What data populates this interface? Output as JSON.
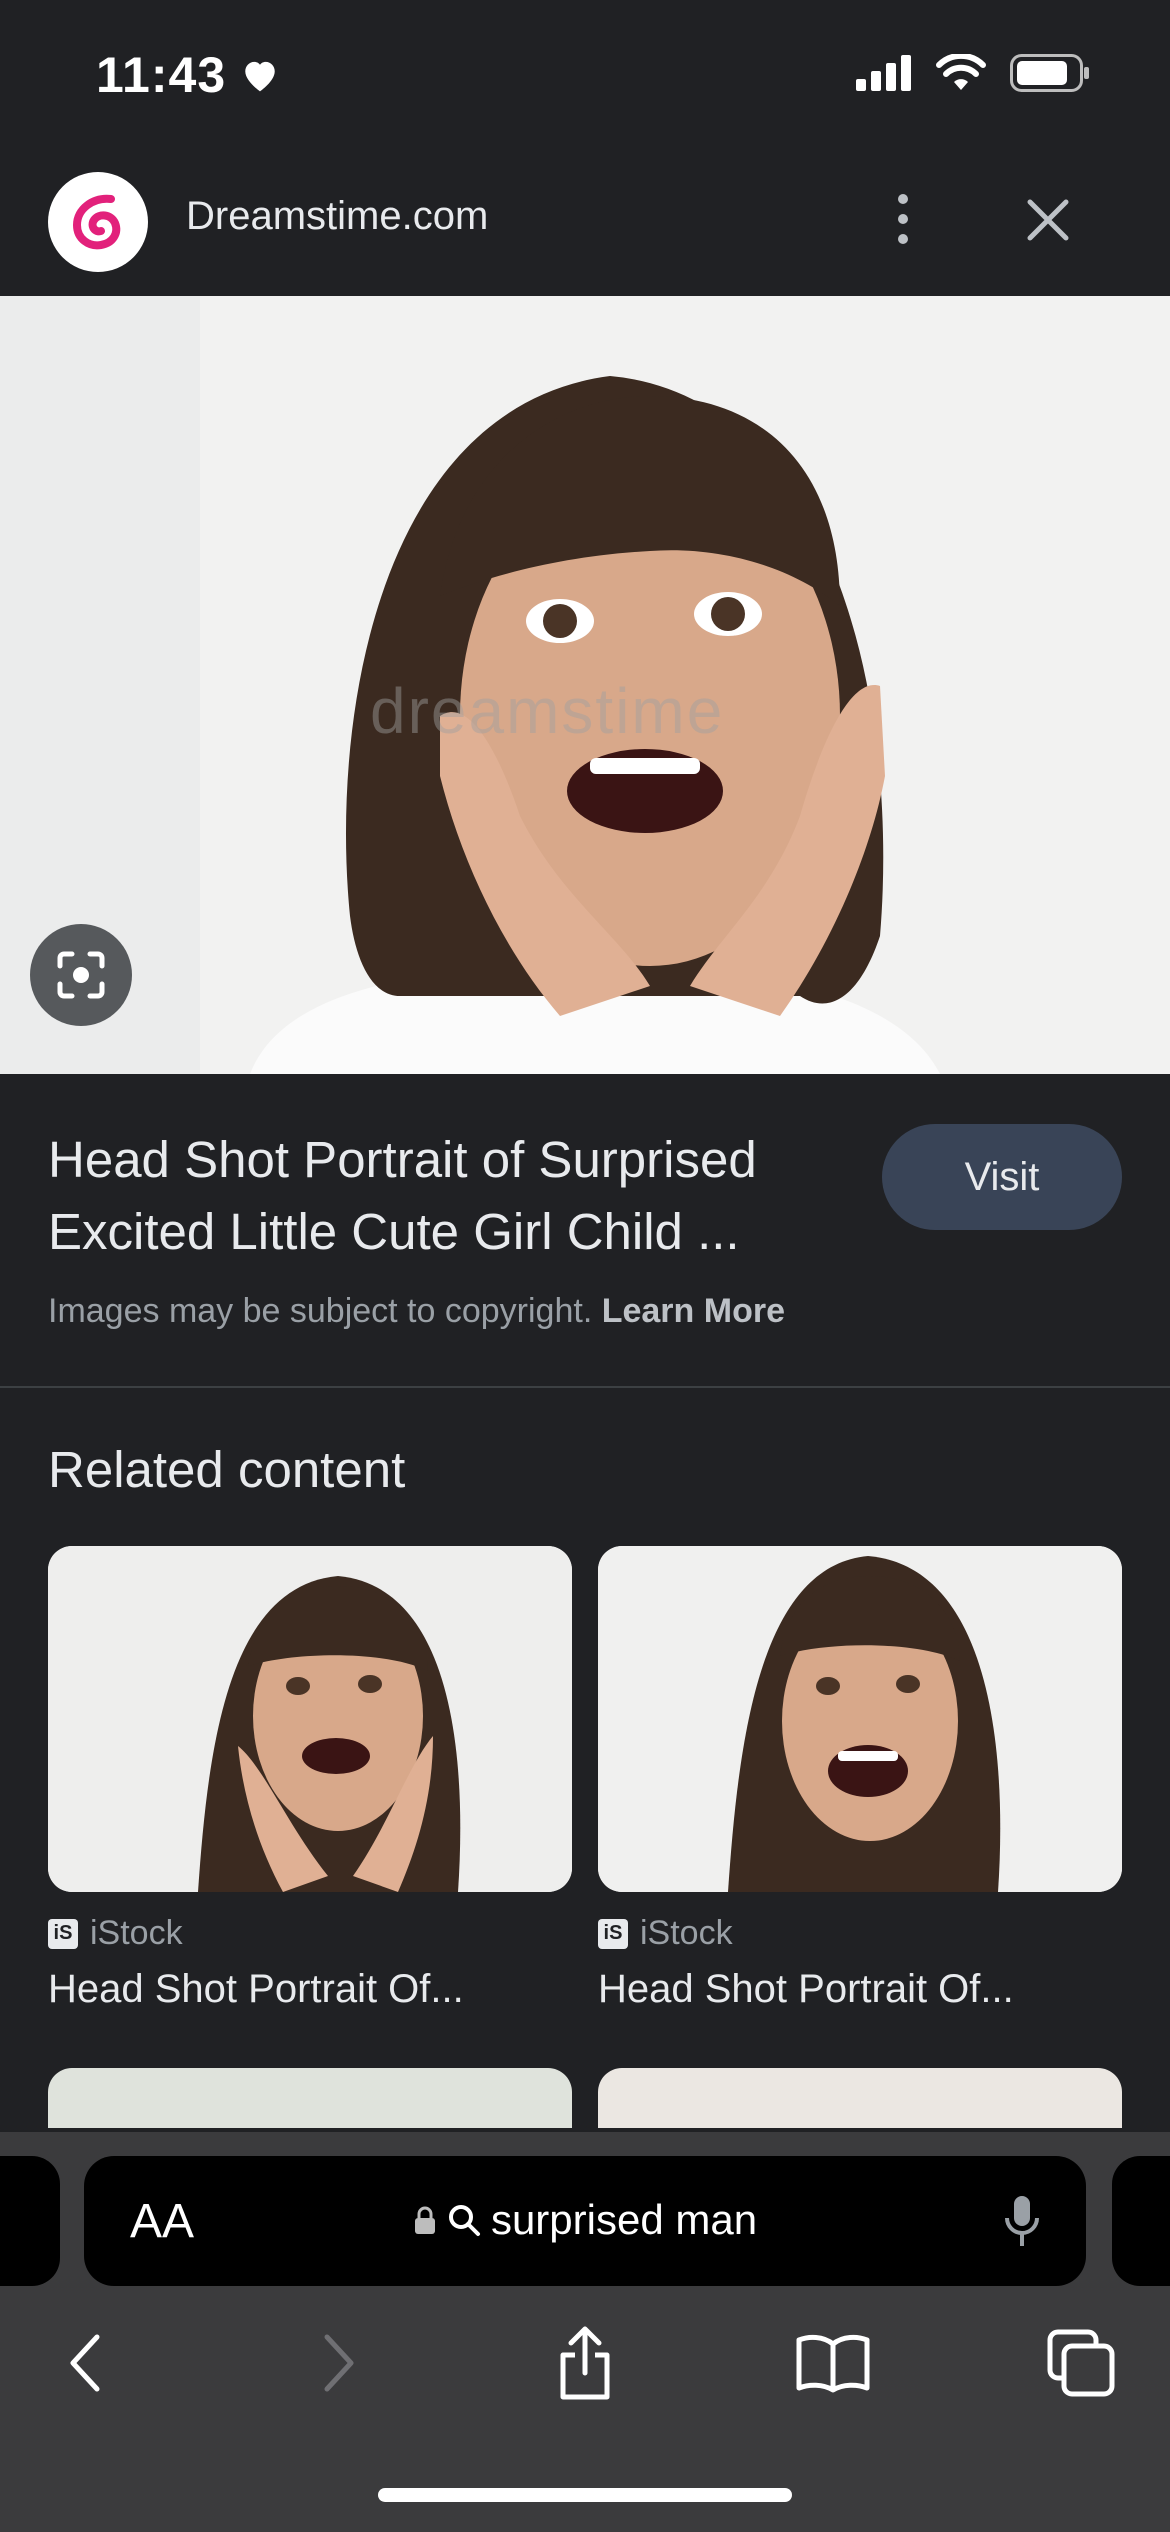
{
  "status_bar": {
    "time": "11:43"
  },
  "header": {
    "site_name": "Dreamstime.com"
  },
  "hero": {
    "watermark": "dreamstime"
  },
  "info": {
    "title_line1": "Head Shot Portrait of Surprised",
    "title_line2": "Excited Little Cute Girl Child ...",
    "visit_label": "Visit",
    "copyright_text": "Images may be subject to copyright.",
    "learn_more": "Learn More"
  },
  "related": {
    "heading": "Related content",
    "items": [
      {
        "source": "iStock",
        "source_icon": "iS",
        "title": "Head Shot Portrait Of..."
      },
      {
        "source": "iStock",
        "source_icon": "iS",
        "title": "Head Shot Portrait Of..."
      }
    ]
  },
  "address_bar": {
    "text_size_label": "AA",
    "query": "surprised man"
  },
  "colors": {
    "background": "#202124",
    "visit_button": "#394457",
    "toolbar": "#3b3b3d",
    "logo_accent": "#e2217b"
  },
  "icons": [
    "heart-icon",
    "signal-icon",
    "wifi-icon",
    "battery-icon",
    "more-vert-icon",
    "close-icon",
    "lens-icon",
    "lock-icon",
    "search-icon",
    "mic-icon",
    "back-icon",
    "forward-icon",
    "share-icon",
    "bookmarks-icon",
    "tabs-icon"
  ]
}
